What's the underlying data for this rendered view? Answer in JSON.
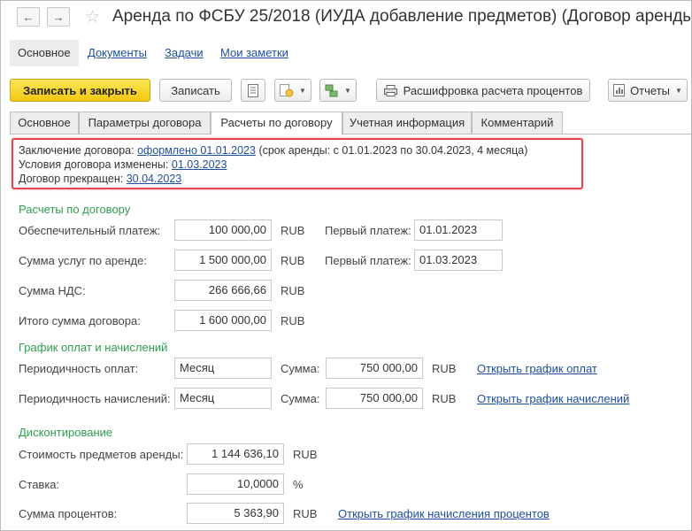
{
  "window": {
    "title": "Аренда по ФСБУ 25/2018 (ИУДА  добавление предметов) (Договор аренды"
  },
  "nav_tabs": [
    {
      "label": "Основное"
    },
    {
      "label": "Документы"
    },
    {
      "label": "Задачи"
    },
    {
      "label": "Мои заметки"
    }
  ],
  "toolbar": {
    "save_close": "Записать и закрыть",
    "save": "Записать",
    "interest_breakdown": "Расшифровка расчета процентов",
    "reports": "Отчеты"
  },
  "tabs": [
    {
      "label": "Основное"
    },
    {
      "label": "Параметры договора"
    },
    {
      "label": "Расчеты по договору"
    },
    {
      "label": "Учетная информация"
    },
    {
      "label": "Комментарий"
    }
  ],
  "info": {
    "conclusion_label": "Заключение договора:",
    "conclusion_link": "оформлено 01.01.2023",
    "conclusion_rest": "(срок аренды: с 01.01.2023 по 30.04.2023, 4 месяца)",
    "changed_label": "Условия договора изменены:",
    "changed_link": "01.03.2023",
    "terminated_label": "Договор прекращен:",
    "terminated_link": "30.04.2023"
  },
  "settlements": {
    "header": "Расчеты по договору",
    "security_label": "Обеспечительный платеж:",
    "security_value": "100 000,00",
    "services_label": "Сумма услуг по аренде:",
    "services_value": "1 500 000,00",
    "vat_label": "Сумма НДС:",
    "vat_value": "266 666,66",
    "total_label": "Итого сумма договора:",
    "total_value": "1 600 000,00",
    "currency": "RUB",
    "first_payment_label": "Первый платеж:",
    "first_payment_1": "01.01.2023",
    "first_payment_2": "01.03.2023"
  },
  "schedule": {
    "header": "График оплат и начислений",
    "payment_freq_label": "Периодичность оплат:",
    "payment_freq_value": "Месяц",
    "accrual_freq_label": "Периодичность начислений:",
    "accrual_freq_value": "Месяц",
    "sum_label": "Сумма:",
    "payment_sum": "750 000,00",
    "accrual_sum": "750 000,00",
    "currency": "RUB",
    "open_payments_link": "Открыть график оплат",
    "open_accruals_link": "Открыть график начислений"
  },
  "discounting": {
    "header": "Дисконтирование",
    "asset_cost_label": "Стоимость предметов аренды:",
    "asset_cost_value": "1 144 636,10",
    "rate_label": "Ставка:",
    "rate_value": "10,0000",
    "rate_unit": "%",
    "interest_label": "Сумма процентов:",
    "interest_value": "5 363,90",
    "currency": "RUB",
    "open_interest_link": "Открыть график начисления процентов"
  },
  "colors": {
    "primary_button": "#f2c711",
    "section_header": "#2e9d4f",
    "link": "#1e4fa0",
    "highlight_border": "#e2474f"
  }
}
